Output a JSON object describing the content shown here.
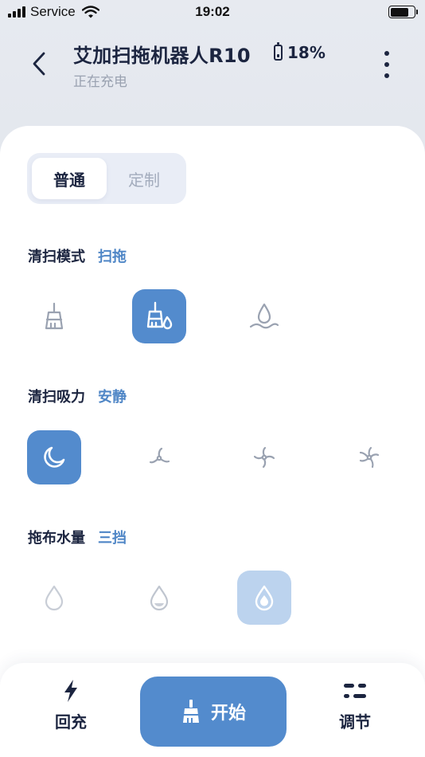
{
  "status_bar": {
    "carrier": "Service",
    "time": "19:02"
  },
  "header": {
    "title": "艾加扫拖机器人R10",
    "battery": "18%",
    "status": "正在充电"
  },
  "tabs": [
    {
      "label": "普通",
      "active": true
    },
    {
      "label": "定制",
      "active": false
    }
  ],
  "clean_mode": {
    "label": "清扫模式",
    "value": "扫拖",
    "options": [
      {
        "icon": "broom-icon",
        "selected": false
      },
      {
        "icon": "sweep-mop-icon",
        "selected": true
      },
      {
        "icon": "mop-icon",
        "selected": false
      }
    ]
  },
  "suction": {
    "label": "清扫吸力",
    "value": "安静",
    "options": [
      {
        "icon": "moon-icon",
        "selected": true
      },
      {
        "icon": "fan-low-icon",
        "selected": false
      },
      {
        "icon": "fan-medium-icon",
        "selected": false
      },
      {
        "icon": "fan-high-icon",
        "selected": false
      }
    ]
  },
  "water": {
    "label": "拖布水量",
    "value": "三挡",
    "options": [
      {
        "icon": "drop-low-icon",
        "selected": false
      },
      {
        "icon": "drop-medium-icon",
        "selected": false
      },
      {
        "icon": "drop-high-icon",
        "selected": true
      }
    ]
  },
  "bottom_bar": {
    "recharge": "回充",
    "start": "开始",
    "adjust": "调节"
  },
  "colors": {
    "accent": "#538bcd",
    "accent_light": "#bcd3ee",
    "text": "#1c2540",
    "muted": "#9aa2b1"
  }
}
